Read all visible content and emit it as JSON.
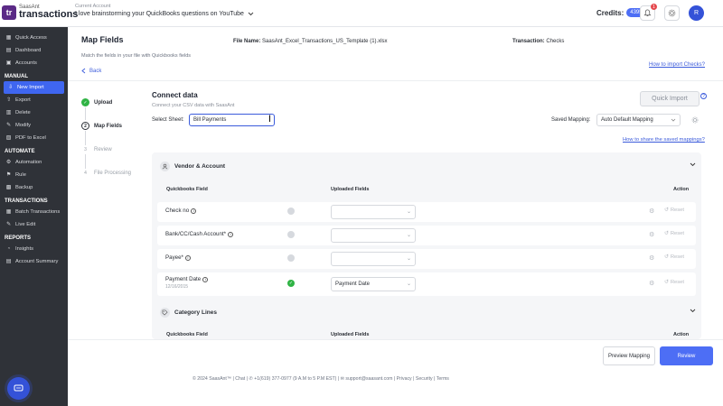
{
  "brand": {
    "small": "SaasAnt",
    "big": "transactions",
    "mark": "tr"
  },
  "account": {
    "label": "Current Account",
    "name": "I love brainstorming your QuickBooks questions on YouTube"
  },
  "header": {
    "credits_label": "Credits:",
    "credits_value": "4395",
    "notif_count": "1",
    "avatar_initial": "R"
  },
  "sidebar": {
    "top_items": [
      {
        "label": "Quick Access",
        "icon": "grid-icon"
      },
      {
        "label": "Dashboard",
        "icon": "dashboard-icon"
      },
      {
        "label": "Accounts",
        "icon": "accounts-icon"
      }
    ],
    "manual_head": "MANUAL",
    "manual_items": [
      {
        "label": "New Import",
        "icon": "import-icon",
        "active": true
      },
      {
        "label": "Export",
        "icon": "export-icon"
      },
      {
        "label": "Delete",
        "icon": "delete-icon"
      },
      {
        "label": "Modify",
        "icon": "modify-icon"
      },
      {
        "label": "PDF to Excel",
        "icon": "pdf-icon"
      }
    ],
    "automate_head": "AUTOMATE",
    "automate_items": [
      {
        "label": "Automation",
        "icon": "automation-icon"
      },
      {
        "label": "Rule",
        "icon": "rule-icon"
      },
      {
        "label": "Backup",
        "icon": "backup-icon"
      }
    ],
    "transactions_head": "TRANSACTIONS",
    "transactions_items": [
      {
        "label": "Batch Transactions",
        "icon": "batch-icon"
      },
      {
        "label": "Live Edit",
        "icon": "edit-icon"
      }
    ],
    "reports_head": "REPORTS",
    "reports_items": [
      {
        "label": "Insights",
        "icon": "insights-icon"
      },
      {
        "label": "Account Summary",
        "icon": "summary-icon"
      }
    ]
  },
  "main": {
    "title": "Map Fields",
    "subtitle": "Match the fields in your file with Quickbooks fields",
    "file_label": "File Name:",
    "file_name": "SaasAnt_Excel_Transactions_US_Template (1).xlsx",
    "txn_label": "Transaction:",
    "txn_value": "Checks",
    "back_label": "Back",
    "howto_link": "How to import Checks?"
  },
  "steps": [
    {
      "num": "✓",
      "label": "Upload",
      "state": "done"
    },
    {
      "num": "2",
      "label": "Map Fields",
      "state": "current"
    },
    {
      "num": "3",
      "label": "Review",
      "state": "todo"
    },
    {
      "num": "4",
      "label": "File Processing",
      "state": "todo"
    }
  ],
  "connect": {
    "title": "Connect data",
    "subtitle": "Connect your CSV data with SaasAnt",
    "quick_import": "Quick Import",
    "sheet_label": "Select Sheet:",
    "sheet_value": "Bill Payments",
    "saved_mapping_label": "Saved Mapping:",
    "saved_mapping_value": "Auto Default Mapping",
    "share_link": "How to share the saved mappings?"
  },
  "vendor_section": {
    "title": "Vendor & Account",
    "col_field": "Quickbooks Field",
    "col_uploaded": "Uploaded Fields",
    "col_action": "Action",
    "rows": [
      {
        "label": "Check no",
        "sub": "",
        "value": "",
        "mapped": false,
        "reset": "Reset"
      },
      {
        "label": "Bank/CC/Cash Account*",
        "sub": "",
        "value": "",
        "mapped": false,
        "reset": "Reset"
      },
      {
        "label": "Payee*",
        "sub": "",
        "value": "",
        "mapped": false,
        "reset": "Reset"
      },
      {
        "label": "Payment Date",
        "sub": "12/16/2015",
        "value": "Payment Date",
        "mapped": true,
        "reset": "Reset"
      }
    ]
  },
  "category_section": {
    "title": "Category Lines",
    "col_field": "Quickbooks Field",
    "col_uploaded": "Uploaded Fields",
    "col_action": "Action"
  },
  "buttons": {
    "preview": "Preview Mapping",
    "review": "Review"
  },
  "footer": "© 2024 SaasAnt™ | Chat | ✆ +1(619) 377-0977 (9 A.M to 5 P.M EST) | ✉ support@saasant.com | Privacy | Security | Terms",
  "colors": {
    "accent": "#3f66f0",
    "sidebar_bg": "#2f3238",
    "success": "#2fb344",
    "brand": "#5b2a86"
  }
}
